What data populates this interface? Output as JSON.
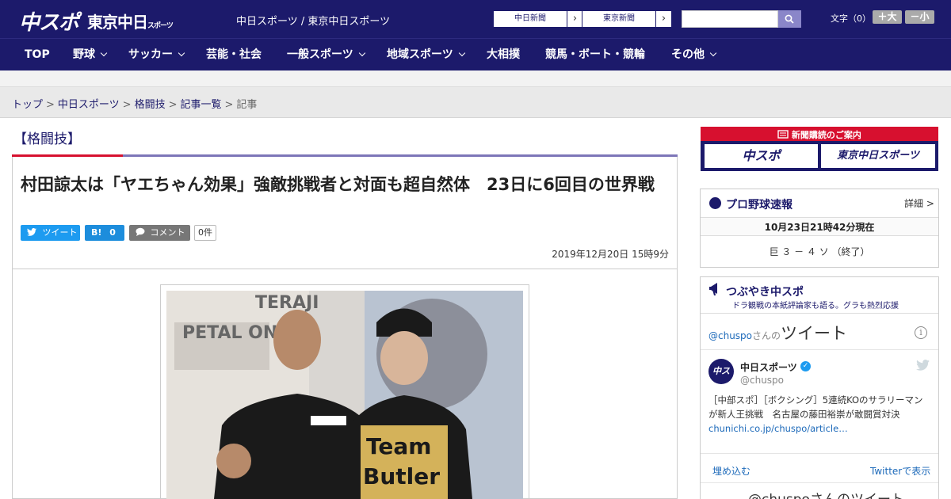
{
  "header": {
    "logo_main": "中スポ",
    "logo_tokyo": "東京中日",
    "logo_tokyo_small": "スポーツ",
    "site_names": "中日スポーツ / 東京中日スポーツ",
    "paper_buttons": [
      "中日新聞",
      "東京新聞"
    ],
    "font_size_label": "文字（0）",
    "size_up": "＋大",
    "size_down": "－小"
  },
  "nav": [
    {
      "label": "TOP",
      "dropdown": false
    },
    {
      "label": "野球",
      "dropdown": true
    },
    {
      "label": "サッカー",
      "dropdown": true
    },
    {
      "label": "芸能・社会",
      "dropdown": false
    },
    {
      "label": "一般スポーツ",
      "dropdown": true
    },
    {
      "label": "地域スポーツ",
      "dropdown": true
    },
    {
      "label": "大相撲",
      "dropdown": false
    },
    {
      "label": "競馬・ボート・競輪",
      "dropdown": false
    },
    {
      "label": "その他",
      "dropdown": true
    }
  ],
  "breadcrumb": [
    "トップ",
    "中日スポーツ",
    "格闘技",
    "記事一覧",
    "記事"
  ],
  "article": {
    "category": "【格闘技】",
    "headline": "村田諒太は「ヤエちゃん効果」強敵挑戦者と対面も超自然体　23日に6回目の世界戦",
    "tweet_label": "ツイート",
    "hatena_label": "B!",
    "hatena_count": "0",
    "comment_label": "コメント",
    "comment_count": "0件",
    "date": "2019年12月20日 15時9分"
  },
  "sidebar": {
    "subscription_title": "新聞購読のご案内",
    "subscription_items": [
      "中スポ",
      "東京中日スポーツ"
    ],
    "baseball": {
      "title": "プロ野球速報",
      "detail_link": "詳細 >",
      "time": "10月23日21時42分現在",
      "score": "巨 ３ － ４ ソ （終了）"
    },
    "tsubuyaki": {
      "title": "つぶやき中スポ",
      "subtitle": "ドラ観戦の本紙評論家も語る。グラも熱烈応援",
      "header_handle": "@chuspo",
      "header_suffix": "さんの",
      "header_big": "ツイート",
      "author_name": "中日スポーツ",
      "author_handle": "@chuspo",
      "avatar_text": "中スポ",
      "tweet_text": "［中部スポ］［ボクシング］5連続KOのサラリーマンが新人王挑戦　名古屋の藤田裕崇が敢闘賞対決",
      "tweet_link": "chunichi.co.jp/chuspo/article…",
      "embed_label": "埋め込む",
      "view_on_twitter": "Twitterで表示",
      "bottom_text": "@chuspoさんのツイート"
    }
  },
  "colors": {
    "brand_navy": "#1c1a6b",
    "accent_red": "#d7102f",
    "twitter_blue": "#1d9bf0"
  }
}
